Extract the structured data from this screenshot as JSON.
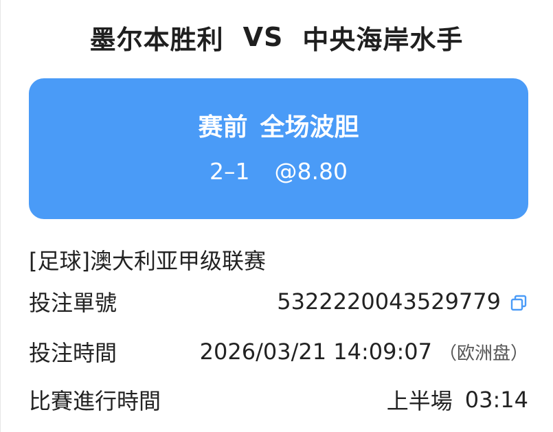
{
  "match": {
    "home": "墨尔本胜利",
    "vs": "VS",
    "away": "中央海岸水手"
  },
  "bet": {
    "stage": "赛前",
    "market": "全场波胆",
    "selection": "2–1",
    "odds": "@8.80",
    "card_color": "#4a9bf7"
  },
  "league": "[足球]澳大利亚甲级联赛",
  "details": {
    "bet_id_label": "投注單號",
    "bet_id_value": "5322220043529779",
    "copy_icon": "copy-icon",
    "bet_time_label": "投注時間",
    "bet_time_value": "2026/03/21 14:09:07",
    "odds_format": "（欧洲盘）",
    "elapsed_label": "比賽進行時間",
    "elapsed_period": "上半場",
    "elapsed_clock": "03:14"
  }
}
